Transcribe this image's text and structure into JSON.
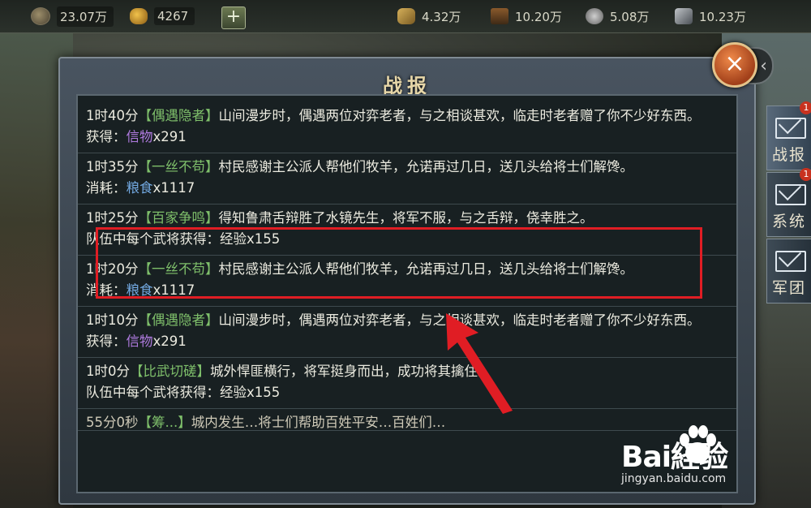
{
  "resources": {
    "copper": "23.07万",
    "gold": "4267",
    "grain": "4.32万",
    "wood": "10.20万",
    "stone": "5.08万",
    "iron": "10.23万",
    "add": "+"
  },
  "panel": {
    "title": "战报",
    "close": "×",
    "back": "‹"
  },
  "side_tabs": [
    {
      "label": "战报",
      "badge": "1"
    },
    {
      "label": "系统",
      "badge": "1"
    },
    {
      "label": "军团",
      "badge": ""
    }
  ],
  "entries": [
    {
      "time": "1时40分",
      "event": "【偶遇隐者】",
      "text": "山间漫步时，偶遇两位对弈老者，与之相谈甚欢，临走时老者赠了你不少好东西。",
      "reward_label": "获得：",
      "item": "信物",
      "qty": "x291",
      "item_color": "purple"
    },
    {
      "time": "1时35分",
      "event": "【一丝不苟】",
      "text": "村民感谢主公派人帮他们牧羊，允诺再过几日，送几头给将士们解馋。",
      "reward_label": "消耗：",
      "item": "粮食",
      "qty": "x1117",
      "item_color": "blue"
    },
    {
      "time": "1时25分",
      "event": "【百家争鸣】",
      "text": "得知鲁肃舌辩胜了水镜先生，将军不服，与之舌辩，侥幸胜之。",
      "reward_label": "队伍中每个武将获得：",
      "item": "经验",
      "qty": "x155",
      "item_color": "plain"
    },
    {
      "time": "1时20分",
      "event": "【一丝不苟】",
      "text": "村民感谢主公派人帮他们牧羊，允诺再过几日，送几头给将士们解馋。",
      "reward_label": "消耗：",
      "item": "粮食",
      "qty": "x1117",
      "item_color": "blue"
    },
    {
      "time": "1时10分",
      "event": "【偶遇隐者】",
      "text": "山间漫步时，偶遇两位对弈老者，与之相谈甚欢，临走时老者赠了你不少好东西。",
      "reward_label": "获得：",
      "item": "信物",
      "qty": "x291",
      "item_color": "purple"
    },
    {
      "time": "1时0分",
      "event": "【比武切磋】",
      "text": "城外悍匪横行，将军挺身而出，成功将其擒住。",
      "reward_label": "队伍中每个武将获得：",
      "item": "经验",
      "qty": "x155",
      "item_color": "plain"
    },
    {
      "time": "55分0秒",
      "event": "【筹...】",
      "text": "城内发生…将士们帮助百姓平安…百姓们…",
      "reward_label": "",
      "item": "",
      "qty": "",
      "item_color": "plain"
    }
  ],
  "watermark": {
    "logo": "Bai経验",
    "url": "jingyan.baidu.com"
  },
  "colors": {
    "event_green": "#7fc06b",
    "item_purple": "#b07be0",
    "item_blue": "#72a8e0",
    "highlight_red": "#e01d24"
  }
}
